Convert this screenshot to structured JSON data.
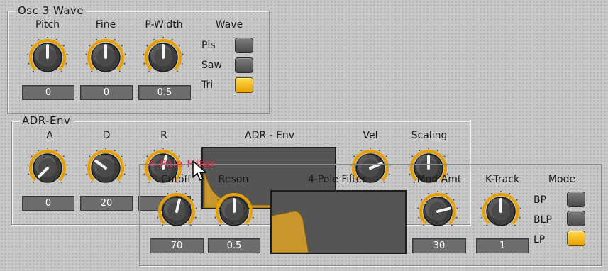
{
  "osc3": {
    "title": "Osc 3 Wave",
    "knobs": [
      {
        "label": "Pitch",
        "value": "0",
        "level": 0.5
      },
      {
        "label": "Fine",
        "value": "0",
        "level": 0.5
      },
      {
        "label": "P-Width",
        "value": "0.5",
        "level": 0.5
      }
    ],
    "wave": {
      "label": "Wave",
      "options": [
        {
          "label": "Pls",
          "selected": false
        },
        {
          "label": "Saw",
          "selected": false
        },
        {
          "label": "Tri",
          "selected": true
        }
      ]
    }
  },
  "adr": {
    "title": "ADR-Env",
    "display_label": "ADR - Env",
    "knobs": [
      {
        "label": "A",
        "value": "0",
        "level": 0.0
      },
      {
        "label": "D",
        "value": "20",
        "level": 0.3
      },
      {
        "label": "R",
        "value": "",
        "level": 0.55
      },
      {
        "label": "Vel",
        "value": "",
        "level": 0.75
      },
      {
        "label": "Scaling",
        "value": "",
        "level": 0.5
      }
    ]
  },
  "filter": {
    "title": "4-Pole Filter",
    "display_label": "4-Pole Filter",
    "knobs": [
      {
        "label": "Cutoff",
        "value": "70",
        "level": 0.55
      },
      {
        "label": "Reson",
        "value": "0.5",
        "level": 0.5
      },
      {
        "label": "Mod Amt",
        "value": "30",
        "level": 0.78
      },
      {
        "label": "K-Track",
        "value": "1",
        "level": 0.5
      }
    ],
    "mode": {
      "label": "Mode",
      "options": [
        {
          "label": "BP",
          "selected": false
        },
        {
          "label": "BLP",
          "selected": false
        },
        {
          "label": "LP",
          "selected": true
        }
      ]
    }
  },
  "colors": {
    "accent": "#e8a000",
    "display": "#555555",
    "waveform": "#c9962e"
  }
}
